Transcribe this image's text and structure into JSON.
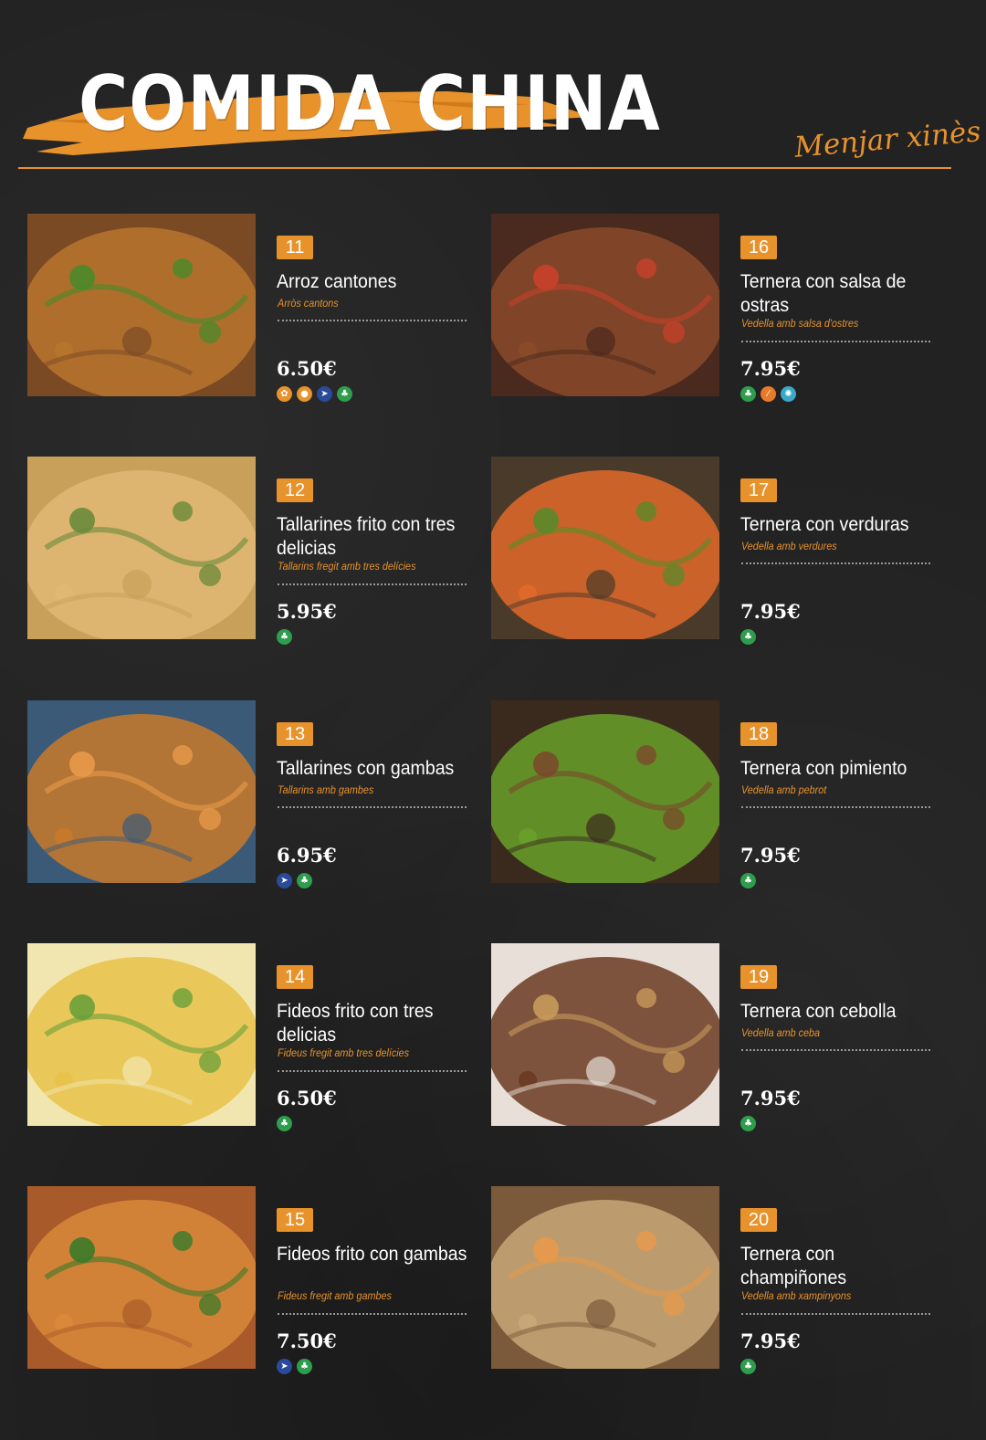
{
  "header": {
    "title": "COMIDA CHINA",
    "subtitle": "Menjar xinès"
  },
  "colors": {
    "accent": "#e8922c",
    "background": "#222222"
  },
  "allergen_legend": {
    "gluten-icon": "#e8922c",
    "egg-icon": "#e8922c",
    "fish-icon": "#2a4a9a",
    "soy-icon": "#2e9e4e",
    "celery-icon": "#2e9e4e",
    "mustard-icon": "#e87a2a",
    "molluscs-icon": "#3aa8c8"
  },
  "items": [
    {
      "number": "11",
      "name": "Arroz cantones",
      "name_ca": "Arròs cantons",
      "price": "6.50€",
      "allergens": [
        "gluten-icon",
        "egg-icon",
        "fish-icon",
        "soy-icon"
      ]
    },
    {
      "number": "12",
      "name": "Tallarines frito con tres delicias",
      "name_ca": "Tallarins fregit amb tres delícies",
      "price": "5.95€",
      "allergens": [
        "soy-icon"
      ]
    },
    {
      "number": "13",
      "name": "Tallarines con gambas",
      "name_ca": "Tallarins amb gambes",
      "price": "6.95€",
      "allergens": [
        "fish-icon",
        "soy-icon"
      ]
    },
    {
      "number": "14",
      "name": "Fideos frito con tres delicias",
      "name_ca": "Fideus fregit amb tres delícies",
      "price": "6.50€",
      "allergens": [
        "soy-icon"
      ]
    },
    {
      "number": "15",
      "name": "Fideos frito con gambas",
      "name_ca": "Fideus fregit amb gambes",
      "price": "7.50€",
      "allergens": [
        "fish-icon",
        "soy-icon"
      ]
    },
    {
      "number": "16",
      "name": "Ternera con salsa de ostras",
      "name_ca": "Vedella amb salsa d'ostres",
      "price": "7.95€",
      "allergens": [
        "soy-icon",
        "mustard-icon",
        "molluscs-icon"
      ]
    },
    {
      "number": "17",
      "name": "Ternera con verduras",
      "name_ca": "Vedella amb verdures",
      "price": "7.95€",
      "allergens": [
        "soy-icon"
      ]
    },
    {
      "number": "18",
      "name": "Ternera con pimiento",
      "name_ca": "Vedella amb pebrot",
      "price": "7.95€",
      "allergens": [
        "soy-icon"
      ]
    },
    {
      "number": "19",
      "name": "Ternera con cebolla",
      "name_ca": "Vedella amb ceba",
      "price": "7.95€",
      "allergens": [
        "soy-icon"
      ]
    },
    {
      "number": "20",
      "name": "Ternera con champiñones",
      "name_ca": "Vedella amb xampinyons",
      "price": "7.95€",
      "allergens": [
        "soy-icon"
      ]
    }
  ]
}
